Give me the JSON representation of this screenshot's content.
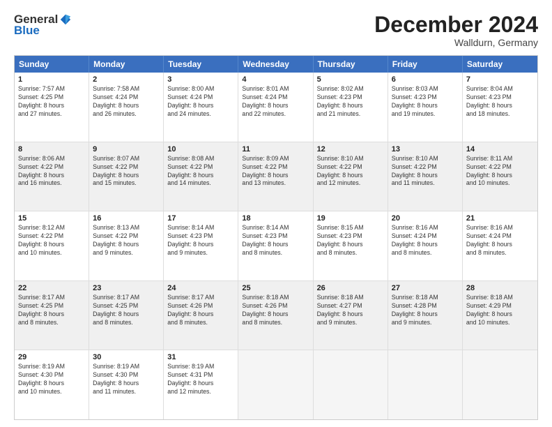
{
  "logo": {
    "general": "General",
    "blue": "Blue"
  },
  "title": "December 2024",
  "location": "Walldurn, Germany",
  "header_days": [
    "Sunday",
    "Monday",
    "Tuesday",
    "Wednesday",
    "Thursday",
    "Friday",
    "Saturday"
  ],
  "rows": [
    [
      {
        "day": "1",
        "info": "Sunrise: 7:57 AM\nSunset: 4:25 PM\nDaylight: 8 hours\nand 27 minutes."
      },
      {
        "day": "2",
        "info": "Sunrise: 7:58 AM\nSunset: 4:24 PM\nDaylight: 8 hours\nand 26 minutes."
      },
      {
        "day": "3",
        "info": "Sunrise: 8:00 AM\nSunset: 4:24 PM\nDaylight: 8 hours\nand 24 minutes."
      },
      {
        "day": "4",
        "info": "Sunrise: 8:01 AM\nSunset: 4:24 PM\nDaylight: 8 hours\nand 22 minutes."
      },
      {
        "day": "5",
        "info": "Sunrise: 8:02 AM\nSunset: 4:23 PM\nDaylight: 8 hours\nand 21 minutes."
      },
      {
        "day": "6",
        "info": "Sunrise: 8:03 AM\nSunset: 4:23 PM\nDaylight: 8 hours\nand 19 minutes."
      },
      {
        "day": "7",
        "info": "Sunrise: 8:04 AM\nSunset: 4:23 PM\nDaylight: 8 hours\nand 18 minutes."
      }
    ],
    [
      {
        "day": "8",
        "info": "Sunrise: 8:06 AM\nSunset: 4:22 PM\nDaylight: 8 hours\nand 16 minutes."
      },
      {
        "day": "9",
        "info": "Sunrise: 8:07 AM\nSunset: 4:22 PM\nDaylight: 8 hours\nand 15 minutes."
      },
      {
        "day": "10",
        "info": "Sunrise: 8:08 AM\nSunset: 4:22 PM\nDaylight: 8 hours\nand 14 minutes."
      },
      {
        "day": "11",
        "info": "Sunrise: 8:09 AM\nSunset: 4:22 PM\nDaylight: 8 hours\nand 13 minutes."
      },
      {
        "day": "12",
        "info": "Sunrise: 8:10 AM\nSunset: 4:22 PM\nDaylight: 8 hours\nand 12 minutes."
      },
      {
        "day": "13",
        "info": "Sunrise: 8:10 AM\nSunset: 4:22 PM\nDaylight: 8 hours\nand 11 minutes."
      },
      {
        "day": "14",
        "info": "Sunrise: 8:11 AM\nSunset: 4:22 PM\nDaylight: 8 hours\nand 10 minutes."
      }
    ],
    [
      {
        "day": "15",
        "info": "Sunrise: 8:12 AM\nSunset: 4:22 PM\nDaylight: 8 hours\nand 10 minutes."
      },
      {
        "day": "16",
        "info": "Sunrise: 8:13 AM\nSunset: 4:22 PM\nDaylight: 8 hours\nand 9 minutes."
      },
      {
        "day": "17",
        "info": "Sunrise: 8:14 AM\nSunset: 4:23 PM\nDaylight: 8 hours\nand 9 minutes."
      },
      {
        "day": "18",
        "info": "Sunrise: 8:14 AM\nSunset: 4:23 PM\nDaylight: 8 hours\nand 8 minutes."
      },
      {
        "day": "19",
        "info": "Sunrise: 8:15 AM\nSunset: 4:23 PM\nDaylight: 8 hours\nand 8 minutes."
      },
      {
        "day": "20",
        "info": "Sunrise: 8:16 AM\nSunset: 4:24 PM\nDaylight: 8 hours\nand 8 minutes."
      },
      {
        "day": "21",
        "info": "Sunrise: 8:16 AM\nSunset: 4:24 PM\nDaylight: 8 hours\nand 8 minutes."
      }
    ],
    [
      {
        "day": "22",
        "info": "Sunrise: 8:17 AM\nSunset: 4:25 PM\nDaylight: 8 hours\nand 8 minutes."
      },
      {
        "day": "23",
        "info": "Sunrise: 8:17 AM\nSunset: 4:25 PM\nDaylight: 8 hours\nand 8 minutes."
      },
      {
        "day": "24",
        "info": "Sunrise: 8:17 AM\nSunset: 4:26 PM\nDaylight: 8 hours\nand 8 minutes."
      },
      {
        "day": "25",
        "info": "Sunrise: 8:18 AM\nSunset: 4:26 PM\nDaylight: 8 hours\nand 8 minutes."
      },
      {
        "day": "26",
        "info": "Sunrise: 8:18 AM\nSunset: 4:27 PM\nDaylight: 8 hours\nand 9 minutes."
      },
      {
        "day": "27",
        "info": "Sunrise: 8:18 AM\nSunset: 4:28 PM\nDaylight: 8 hours\nand 9 minutes."
      },
      {
        "day": "28",
        "info": "Sunrise: 8:18 AM\nSunset: 4:29 PM\nDaylight: 8 hours\nand 10 minutes."
      }
    ],
    [
      {
        "day": "29",
        "info": "Sunrise: 8:19 AM\nSunset: 4:30 PM\nDaylight: 8 hours\nand 10 minutes."
      },
      {
        "day": "30",
        "info": "Sunrise: 8:19 AM\nSunset: 4:30 PM\nDaylight: 8 hours\nand 11 minutes."
      },
      {
        "day": "31",
        "info": "Sunrise: 8:19 AM\nSunset: 4:31 PM\nDaylight: 8 hours\nand 12 minutes."
      },
      {
        "day": "",
        "info": ""
      },
      {
        "day": "",
        "info": ""
      },
      {
        "day": "",
        "info": ""
      },
      {
        "day": "",
        "info": ""
      }
    ]
  ]
}
